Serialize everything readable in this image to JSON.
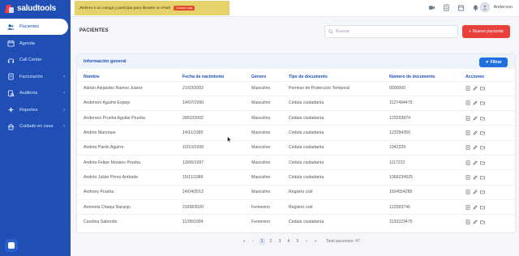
{
  "app": {
    "name": "saludtools"
  },
  "sidebar": {
    "items": [
      {
        "label": "Pacientes",
        "icon": "users-icon",
        "active": true,
        "has_submenu": false
      },
      {
        "label": "Agenda",
        "icon": "calendar-icon",
        "active": false,
        "has_submenu": false
      },
      {
        "label": "Call Center",
        "icon": "headset-icon",
        "active": false,
        "has_submenu": false
      },
      {
        "label": "Facturación",
        "icon": "invoice-icon",
        "active": false,
        "has_submenu": true
      },
      {
        "label": "Auditoría",
        "icon": "audit-icon",
        "active": false,
        "has_submenu": true
      },
      {
        "label": "Reportes",
        "icon": "reports-icon",
        "active": false,
        "has_submenu": true
      },
      {
        "label": "Cuidado en casa",
        "icon": "home-icon",
        "active": false,
        "has_submenu": true
      }
    ],
    "chevron": "›"
  },
  "topbar": {
    "promo_text": "¡Refiere a un colega y participa para llevarte un iPad!",
    "promo_cta": "Conoce más",
    "user_name": "Anderson",
    "icons": [
      "video-icon",
      "document-icon",
      "calendar-icon",
      "bell-icon"
    ]
  },
  "page": {
    "title": "PACIENTES",
    "search_placeholder": "Buscar",
    "new_button_label": "+ Nuevo paciente"
  },
  "card": {
    "title": "Información general",
    "filter_label": "▼ Filtrar"
  },
  "table": {
    "headers": [
      "Nombre",
      "Fecha de nacimiento",
      "Género",
      "Tipo de documento",
      "Número de documento",
      "Acciones"
    ],
    "rows": [
      [
        "Adrián Alejandro Ramos Juárez",
        "21/03/2002",
        "Masculino",
        "Permiso de Protección Temporal",
        "0000000"
      ],
      [
        "Anderson Aguirre Espejo",
        "14/07/1990",
        "Masculino",
        "Cédula ciudadanía",
        "1127494470"
      ],
      [
        "Anderson Prueba Aguilar Prueba",
        "28/02/2002",
        "Masculino",
        "Cédula ciudadanía",
        "123293874"
      ],
      [
        "Andrés Manrique",
        "14/11/1985",
        "Masculino",
        "Cédula ciudadanía",
        "123294350"
      ],
      [
        "Andrés Pardo Aguirre",
        "10/10/1999",
        "Masculino",
        "Cédula ciudadanía",
        "1042229"
      ],
      [
        "Andrés Felipe Morales Prueba",
        "13/06/1997",
        "Masculino",
        "Cédula ciudadanía",
        "1117222"
      ],
      [
        "Andrés Julián Pérez Andrade",
        "15/11/1986",
        "Masculino",
        "Cédula ciudadanía",
        "1066234525"
      ],
      [
        "Anthony Prueba",
        "24/04/2012",
        "Masculino",
        "Registro civil",
        "1164554285"
      ],
      [
        "Antonela Chaqui Naranjo",
        "21/08/2020",
        "Femenino",
        "Registro civil",
        "122593746"
      ],
      [
        "Carolina Saborido",
        "11/09/1994",
        "Femenino",
        "Cédula ciudadanía",
        "1133223475"
      ]
    ]
  },
  "pagination": {
    "prev": "‹",
    "first": "«",
    "pages": [
      "1",
      "2",
      "3",
      "4",
      "5"
    ],
    "current": "1",
    "next": "›",
    "last": "»",
    "total_text": "Total pacientes: 47"
  },
  "colors": {
    "sidebar_bg": "#1f4fb4",
    "accent_red": "#e8413d",
    "primary_blue": "#1f6fe0",
    "promo_bg": "#e6d26a"
  }
}
